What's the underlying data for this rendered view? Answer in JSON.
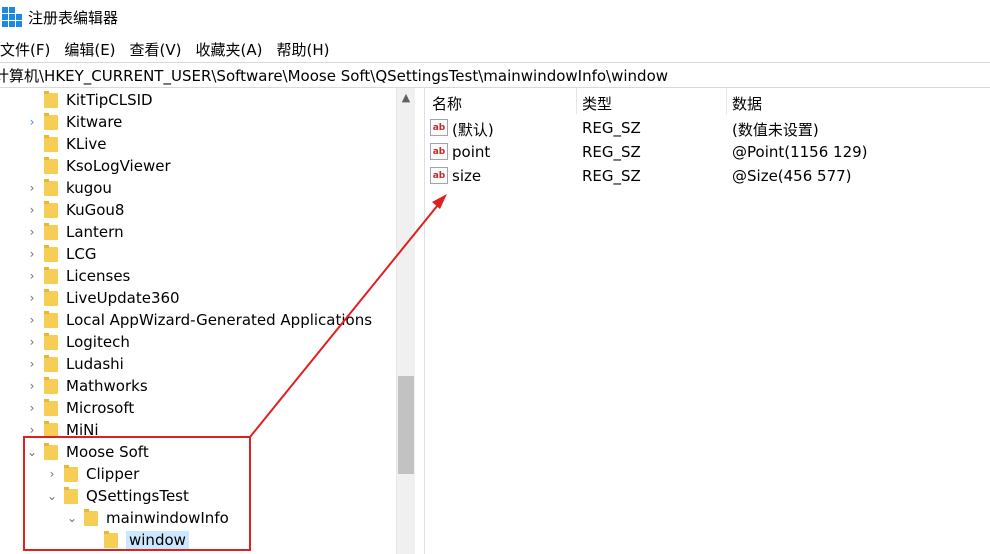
{
  "window": {
    "title": "注册表编辑器"
  },
  "menu": [
    "文件(F)",
    "编辑(E)",
    "查看(V)",
    "收藏夹(A)",
    "帮助(H)"
  ],
  "address": "计算机\\HKEY_CURRENT_USER\\Software\\Moose Soft\\QSettingsTest\\mainwindowInfo\\window",
  "tree": [
    {
      "label": "KitTipCLSID",
      "expander": ""
    },
    {
      "label": "Kitware",
      "expander": "›"
    },
    {
      "label": "KLive",
      "expander": ""
    },
    {
      "label": "KsoLogViewer",
      "expander": ""
    },
    {
      "label": "kugou",
      "expander": "›"
    },
    {
      "label": "KuGou8",
      "expander": "›"
    },
    {
      "label": "Lantern",
      "expander": "›"
    },
    {
      "label": "LCG",
      "expander": "›"
    },
    {
      "label": "Licenses",
      "expander": "›"
    },
    {
      "label": "LiveUpdate360",
      "expander": "›"
    },
    {
      "label": "Local AppWizard-Generated Applications",
      "expander": "›"
    },
    {
      "label": "Logitech",
      "expander": "›"
    },
    {
      "label": "Ludashi",
      "expander": "›"
    },
    {
      "label": "Mathworks",
      "expander": "›"
    },
    {
      "label": "Microsoft",
      "expander": "›"
    },
    {
      "label": "MiNi",
      "expander": "›"
    },
    {
      "label": "Moose Soft",
      "expander": "⌄"
    },
    {
      "label": "Clipper",
      "expander": "›"
    },
    {
      "label": "QSettingsTest",
      "expander": "⌄"
    },
    {
      "label": "mainwindowInfo",
      "expander": "⌄"
    },
    {
      "label": "window",
      "expander": ""
    }
  ],
  "list": {
    "headers": {
      "name": "名称",
      "type": "类型",
      "data": "数据"
    },
    "rows": [
      {
        "name": "(默认)",
        "type": "REG_SZ",
        "data": "(数值未设置)"
      },
      {
        "name": "point",
        "type": "REG_SZ",
        "data": "@Point(1156 129)"
      },
      {
        "name": "size",
        "type": "REG_SZ",
        "data": "@Size(456 577)"
      }
    ],
    "icon_text": "ab"
  },
  "colors": {
    "annotation": "#e02020",
    "selection": "#cce8ff",
    "folder": "#f6cd55",
    "accent": "#1e88e5"
  }
}
